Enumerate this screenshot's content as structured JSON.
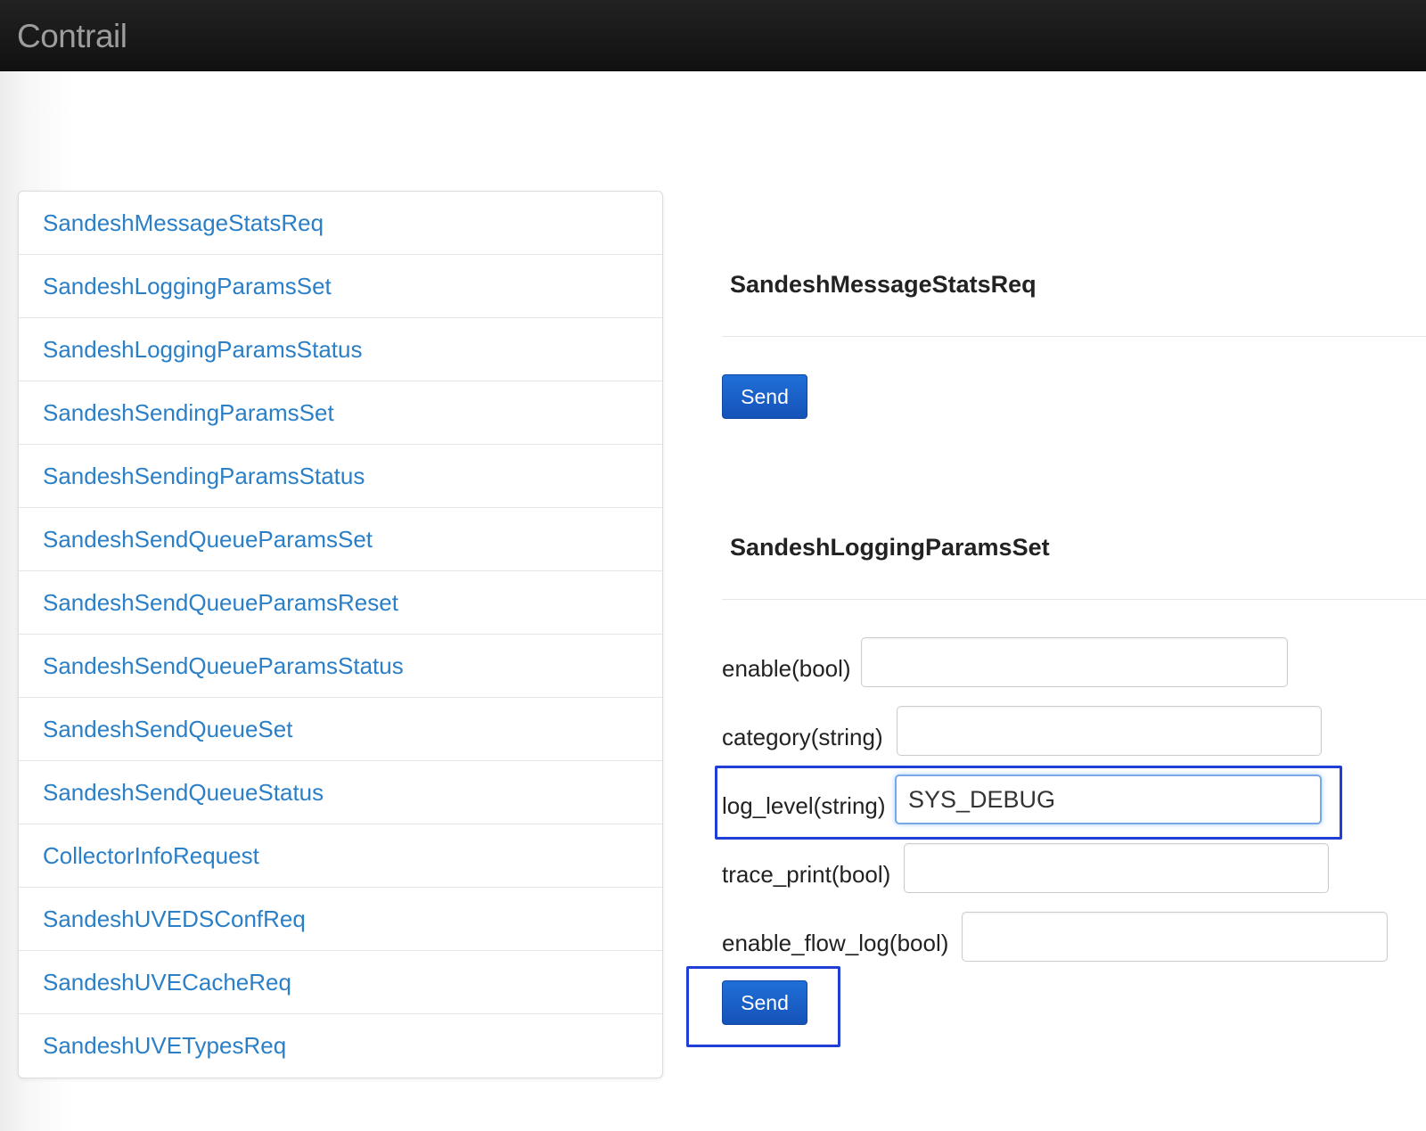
{
  "header": {
    "brand": "Contrail"
  },
  "sidebar": {
    "items": [
      {
        "label": "SandeshMessageStatsReq"
      },
      {
        "label": "SandeshLoggingParamsSet"
      },
      {
        "label": "SandeshLoggingParamsStatus"
      },
      {
        "label": "SandeshSendingParamsSet"
      },
      {
        "label": "SandeshSendingParamsStatus"
      },
      {
        "label": "SandeshSendQueueParamsSet"
      },
      {
        "label": "SandeshSendQueueParamsReset"
      },
      {
        "label": "SandeshSendQueueParamsStatus"
      },
      {
        "label": "SandeshSendQueueSet"
      },
      {
        "label": "SandeshSendQueueStatus"
      },
      {
        "label": "CollectorInfoRequest"
      },
      {
        "label": "SandeshUVEDSConfReq"
      },
      {
        "label": "SandeshUVECacheReq"
      },
      {
        "label": "SandeshUVETypesReq"
      }
    ]
  },
  "main": {
    "sections": [
      {
        "title": "SandeshMessageStatsReq",
        "send_label": "Send"
      },
      {
        "title": "SandeshLoggingParamsSet",
        "send_label": "Send",
        "fields": [
          {
            "label": "enable(bool)",
            "value": ""
          },
          {
            "label": "category(string)",
            "value": ""
          },
          {
            "label": "log_level(string)",
            "value": "SYS_DEBUG"
          },
          {
            "label": "trace_print(bool)",
            "value": ""
          },
          {
            "label": "enable_flow_log(bool)",
            "value": ""
          }
        ]
      }
    ]
  },
  "colors": {
    "topbar": "#111111",
    "link": "#2a7fc7",
    "button": "#1a5fcc",
    "highlight": "#1f3fd6"
  }
}
